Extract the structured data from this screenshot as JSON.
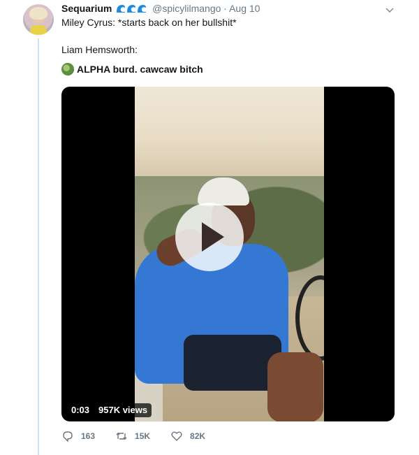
{
  "tweet": {
    "author_name": "Sequarium",
    "author_badges": [
      "wave-icon",
      "wave-icon",
      "wave-icon"
    ],
    "handle": "@spicylilmango",
    "separator": "·",
    "date": "Aug 10",
    "line1": "Miley Cyrus: *starts back on her bullshit*",
    "line2": "Liam Hemsworth:",
    "line3": "ALPHA burd. cawcaw bitch"
  },
  "video": {
    "time": "0:03",
    "views": "957K views"
  },
  "actions": {
    "replies": "163",
    "retweets": "15K",
    "likes": "82K"
  },
  "colors": {
    "accent": "#1da1f2",
    "thread_line": "#cce4f2",
    "muted": "#657786"
  }
}
